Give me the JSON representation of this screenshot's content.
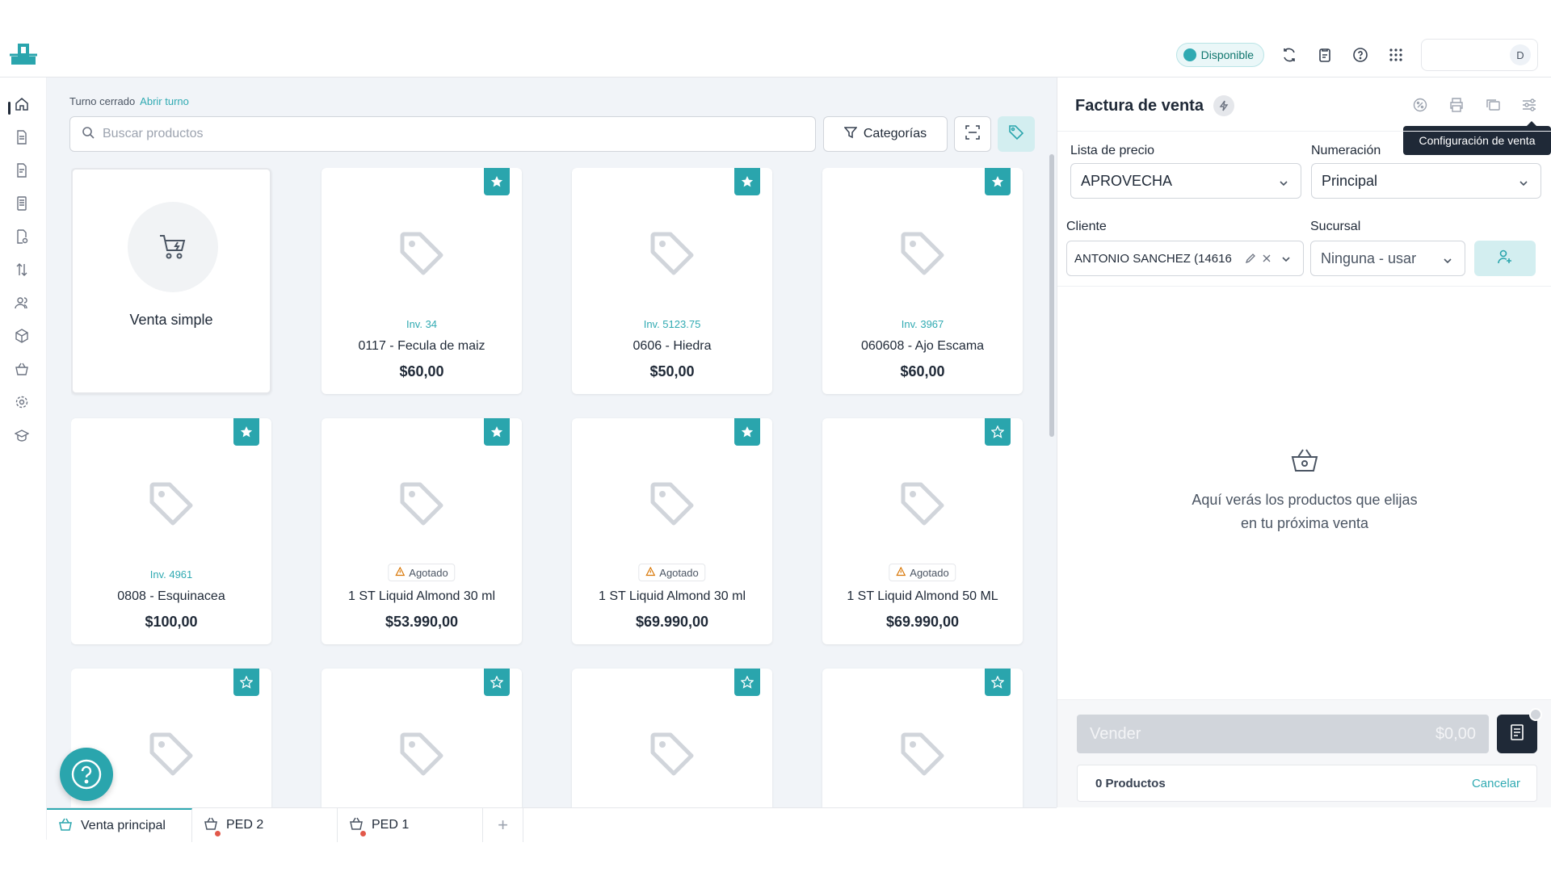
{
  "topbar": {
    "status_label": "Disponible",
    "avatar_initial": "D",
    "accent": "#30aab2"
  },
  "sidebar": {
    "items": [
      "home-icon",
      "invoice-icon",
      "document-icon",
      "receipt-icon",
      "file-search-icon",
      "transfer-icon",
      "users-icon",
      "box-icon",
      "basket-icon",
      "settings-icon",
      "graduation-icon"
    ]
  },
  "main": {
    "shift_status": "Turno cerrado",
    "shift_open_link": "Abrir turno",
    "search_placeholder": "Buscar productos",
    "categories_label": "Categorías",
    "simple_sale_label": "Venta simple",
    "products": [
      {
        "inv": "Inv. 34",
        "name": "0117 - Fecula de maiz",
        "price": "$60,00",
        "fav": true
      },
      {
        "inv": "Inv. 5123.75",
        "name": "0606 - Hiedra",
        "price": "$50,00",
        "fav": true
      },
      {
        "inv": "Inv. 3967",
        "name": "060608 - Ajo Escama",
        "price": "$60,00",
        "fav": true
      },
      {
        "inv": "Inv. 4961",
        "name": "0808 - Esquinacea",
        "price": "$100,00",
        "fav": true
      },
      {
        "badge": "Agotado",
        "name": "1 ST Liquid Almond 30 ml",
        "price": "$53.990,00",
        "fav": true
      },
      {
        "badge": "Agotado",
        "name": "1 ST Liquid Almond 30 ml",
        "price": "$69.990,00",
        "fav": true
      },
      {
        "badge": "Agotado",
        "name": "1 ST Liquid Almond 50 ML",
        "price": "$69.990,00",
        "fav": false
      },
      {
        "fav": false
      },
      {
        "fav": false
      },
      {
        "fav": false
      },
      {
        "fav": false
      }
    ]
  },
  "tabs": [
    {
      "label": "Venta principal",
      "active": true,
      "dot": false
    },
    {
      "label": "PED 2",
      "active": false,
      "dot": true
    },
    {
      "label": "PED 1",
      "active": false,
      "dot": true
    }
  ],
  "panel": {
    "title": "Factura de venta",
    "tooltip": "Configuración de venta",
    "price_list_label": "Lista de precio",
    "price_list_value": "APROVECHA",
    "numbering_label": "Numeración",
    "numbering_value": "Principal",
    "client_label": "Cliente",
    "client_value": "ANTONIO SANCHEZ (14616",
    "branch_label": "Sucursal",
    "branch_value": "Ninguna - usar",
    "empty_line1": "Aquí verás los productos que elijas",
    "empty_line2": "en tu próxima venta",
    "sell_label": "Vender",
    "sell_total": "$0,00",
    "products_count": "0 Productos",
    "cancel_label": "Cancelar"
  }
}
